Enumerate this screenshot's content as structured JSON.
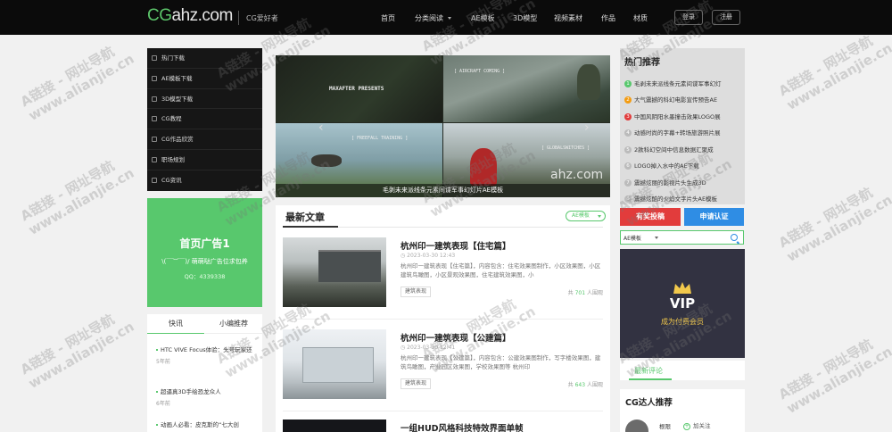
{
  "header": {
    "logo_cg": "CG",
    "logo_rest": "ahz.com",
    "tagline": "CG爱好者",
    "nav": [
      "首页",
      "分类阅读",
      "AE模板",
      "3D模型",
      "视频素材",
      "作品",
      "材质"
    ],
    "login": "登录",
    "register": "注册"
  },
  "categories": [
    "热门下载",
    "AE模板下载",
    "3D模型下载",
    "CG教程",
    "CG作品欣赏",
    "职场规划",
    "CG资讯"
  ],
  "ad": {
    "title": "首页广告1",
    "sub": "\\(￣︶￣)/ 萌萌哒广告位求包养",
    "qq": "QQ：4339338"
  },
  "news": {
    "tabs": [
      "快讯",
      "小编推荐"
    ],
    "items": [
      {
        "title": "HTC VIVE Focus体验：头号玩家还",
        "date": "5年前"
      },
      {
        "title": "超逼真3D手绘恐龙众人",
        "date": "6年前"
      },
      {
        "title": "动画人必看：皮克斯的“七大创",
        "date": ""
      }
    ]
  },
  "slider": {
    "caption": "毛剥未来派线条元素间谍军事幻灯片AE模板",
    "panel_texts": [
      "MAXAFTER PRESENTS",
      "[ AIRCRAFT COMING ]",
      "[ FREEFALL TRAINING ]",
      "[ GLOBALSWITCHES ]"
    ],
    "watermark": "ahz.com"
  },
  "latest": {
    "title": "最新文章",
    "filter": "AE模板",
    "articles": [
      {
        "title": "杭州印一建筑表现【住宅篇】",
        "date": "2023-03-30 12:43",
        "desc": "杭州印一建筑表现【住宅篇】，内容包含：住宅效果图制作，小区效果图，小区建筑鸟瞰图，小区景观效果图，住宅建筑效果图，小",
        "tag": "建筑表现",
        "views_prefix": "共",
        "views": "701",
        "views_suffix": "人围观"
      },
      {
        "title": "杭州印一建筑表现【公建篇】",
        "date": "2023-03-30 12:41",
        "desc": "杭州印一建筑表现【公建篇】，内容包含：公建效果图制作，写字楼效果图，建筑鸟瞰图，产业园区效果图，学校效果图等 杭州印",
        "tag": "建筑表现",
        "views_prefix": "共",
        "views": "643",
        "views_suffix": "人围观"
      },
      {
        "title": "一组HUD风格科技特效界面单帧",
        "date": "",
        "desc": "",
        "tag": "",
        "views_prefix": "",
        "views": "",
        "views_suffix": ""
      }
    ]
  },
  "hot": {
    "title": "热门推荐",
    "items": [
      {
        "n": "1",
        "t": "毛剥未来派线条元素间谍军事幻灯"
      },
      {
        "n": "2",
        "t": "大气震撼的科幻电影宣传预告AE"
      },
      {
        "n": "3",
        "t": "中国风阴阳水墨撞击效果LOGO展"
      },
      {
        "n": "4",
        "t": "动感时尚的字幕+转场旅游照片展"
      },
      {
        "n": "5",
        "t": "2款科幻空间中信息数据汇聚成"
      },
      {
        "n": "6",
        "t": "LOGO掉入水中的AE下载"
      },
      {
        "n": "7",
        "t": "震撼炫丽的影视片头生成3D"
      },
      {
        "n": "8",
        "t": "震撼炫酷的火焰文字片头AE模板"
      }
    ]
  },
  "buttons": {
    "submit": "有奖投稿",
    "certify": "申请认证"
  },
  "search": {
    "scope": "AE模板"
  },
  "vip": {
    "title": "VIP",
    "sub": "成为付费会员"
  },
  "comments": {
    "title": "最新评论"
  },
  "talent": {
    "title": "CG达人推荐",
    "name": "根限",
    "follow": "加关注"
  },
  "watermark": {
    "l1": "A链接 - 网址导航",
    "l2": "www.alianjie.cn"
  },
  "colors": {
    "accent": "#58c86d",
    "red": "#e23c3c",
    "blue": "#2f8de4",
    "vip_bg": "#323241",
    "hot_orange": "#f39c12"
  }
}
